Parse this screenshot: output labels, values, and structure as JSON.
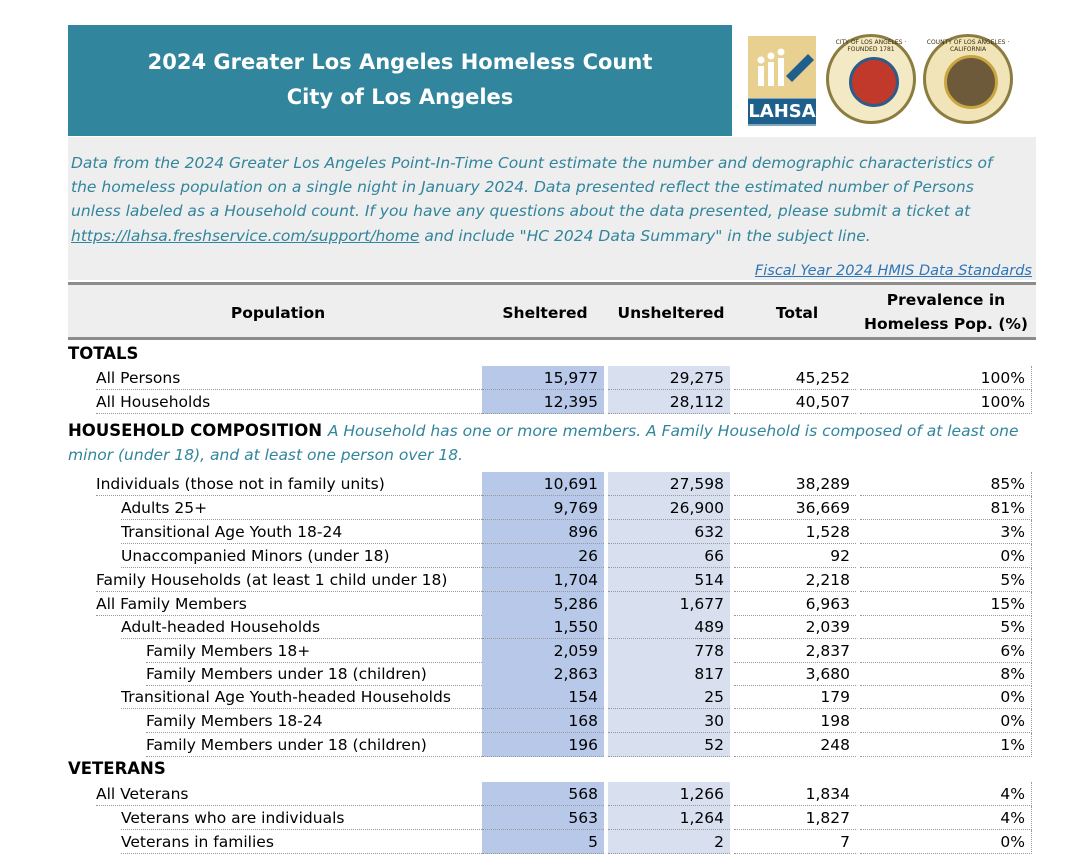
{
  "header": {
    "title_line1": "2024 Greater Los Angeles Homeless Count",
    "title_line2": "City of Los Angeles"
  },
  "logos": {
    "lahsa_label": "LAHSA",
    "city_seal_text": "CITY OF LOS ANGELES · FOUNDED 1781",
    "county_seal_text": "COUNTY OF LOS ANGELES · CALIFORNIA"
  },
  "intro": {
    "text": "Data from the 2024 Greater Los Angeles Point-In-Time Count estimate the number and demographic characteristics of the homeless population on a single night in January 2024. Data presented reflect the estimated number of Persons unless labeled as a Household count. If you have any questions about the data presented, please submit a ticket at",
    "link": "https://lahsa.freshservice.com/support/home",
    "text_after": " and include \"HC 2024 Data Summary\" in the subject line."
  },
  "fiscal_year_note": "Fiscal Year 2024 HMIS Data Standards",
  "columns": {
    "population": "Population",
    "sheltered": "Sheltered",
    "unsheltered": "Unsheltered",
    "total": "Total",
    "prevalence_line1": "Prevalence in",
    "prevalence_line2": "Homeless Pop. (%)"
  },
  "sections": {
    "totals": "TOTALS",
    "household_composition": "HOUSEHOLD COMPOSITION",
    "household_note": "A Household has one or more members. A Family Household is composed of at least one minor (under 18), and at least one person over 18.",
    "veterans": "VETERANS"
  },
  "rows": [
    {
      "label": "All Persons",
      "indent": 1,
      "sheltered": "15,977",
      "unsheltered": "29,275",
      "total": "45,252",
      "pct": "100%"
    },
    {
      "label": "All Households",
      "indent": 1,
      "sheltered": "12,395",
      "unsheltered": "28,112",
      "total": "40,507",
      "pct": "100%"
    },
    {
      "label": "Individuals (those not in family units)",
      "indent": 1,
      "sheltered": "10,691",
      "unsheltered": "27,598",
      "total": "38,289",
      "pct": "85%"
    },
    {
      "label": "Adults 25+",
      "indent": 2,
      "sheltered": "9,769",
      "unsheltered": "26,900",
      "total": "36,669",
      "pct": "81%"
    },
    {
      "label": "Transitional Age Youth 18-24",
      "indent": 2,
      "sheltered": "896",
      "unsheltered": "632",
      "total": "1,528",
      "pct": "3%"
    },
    {
      "label": "Unaccompanied Minors (under 18)",
      "indent": 2,
      "sheltered": "26",
      "unsheltered": "66",
      "total": "92",
      "pct": "0%"
    },
    {
      "label": "Family Households (at least 1 child under 18)",
      "indent": 1,
      "sheltered": "1,704",
      "unsheltered": "514",
      "total": "2,218",
      "pct": "5%"
    },
    {
      "label": "All Family Members",
      "indent": 1,
      "sheltered": "5,286",
      "unsheltered": "1,677",
      "total": "6,963",
      "pct": "15%"
    },
    {
      "label": "Adult-headed Households",
      "indent": 2,
      "sheltered": "1,550",
      "unsheltered": "489",
      "total": "2,039",
      "pct": "5%"
    },
    {
      "label": "Family Members 18+",
      "indent": 3,
      "sheltered": "2,059",
      "unsheltered": "778",
      "total": "2,837",
      "pct": "6%"
    },
    {
      "label": "Family Members under 18 (children)",
      "indent": 3,
      "sheltered": "2,863",
      "unsheltered": "817",
      "total": "3,680",
      "pct": "8%"
    },
    {
      "label": "Transitional Age Youth-headed Households",
      "indent": 2,
      "sheltered": "154",
      "unsheltered": "25",
      "total": "179",
      "pct": "0%"
    },
    {
      "label": "Family Members 18-24",
      "indent": 3,
      "sheltered": "168",
      "unsheltered": "30",
      "total": "198",
      "pct": "0%"
    },
    {
      "label": "Family Members under 18 (children)",
      "indent": 3,
      "sheltered": "196",
      "unsheltered": "52",
      "total": "248",
      "pct": "1%"
    },
    {
      "label": "All Veterans",
      "indent": 1,
      "sheltered": "568",
      "unsheltered": "1,266",
      "total": "1,834",
      "pct": "4%"
    },
    {
      "label": "Veterans who are individuals",
      "indent": 2,
      "sheltered": "563",
      "unsheltered": "1,264",
      "total": "1,827",
      "pct": "4%"
    },
    {
      "label": "Veterans in families",
      "indent": 2,
      "sheltered": "5",
      "unsheltered": "2",
      "total": "7",
      "pct": "0%"
    }
  ]
}
